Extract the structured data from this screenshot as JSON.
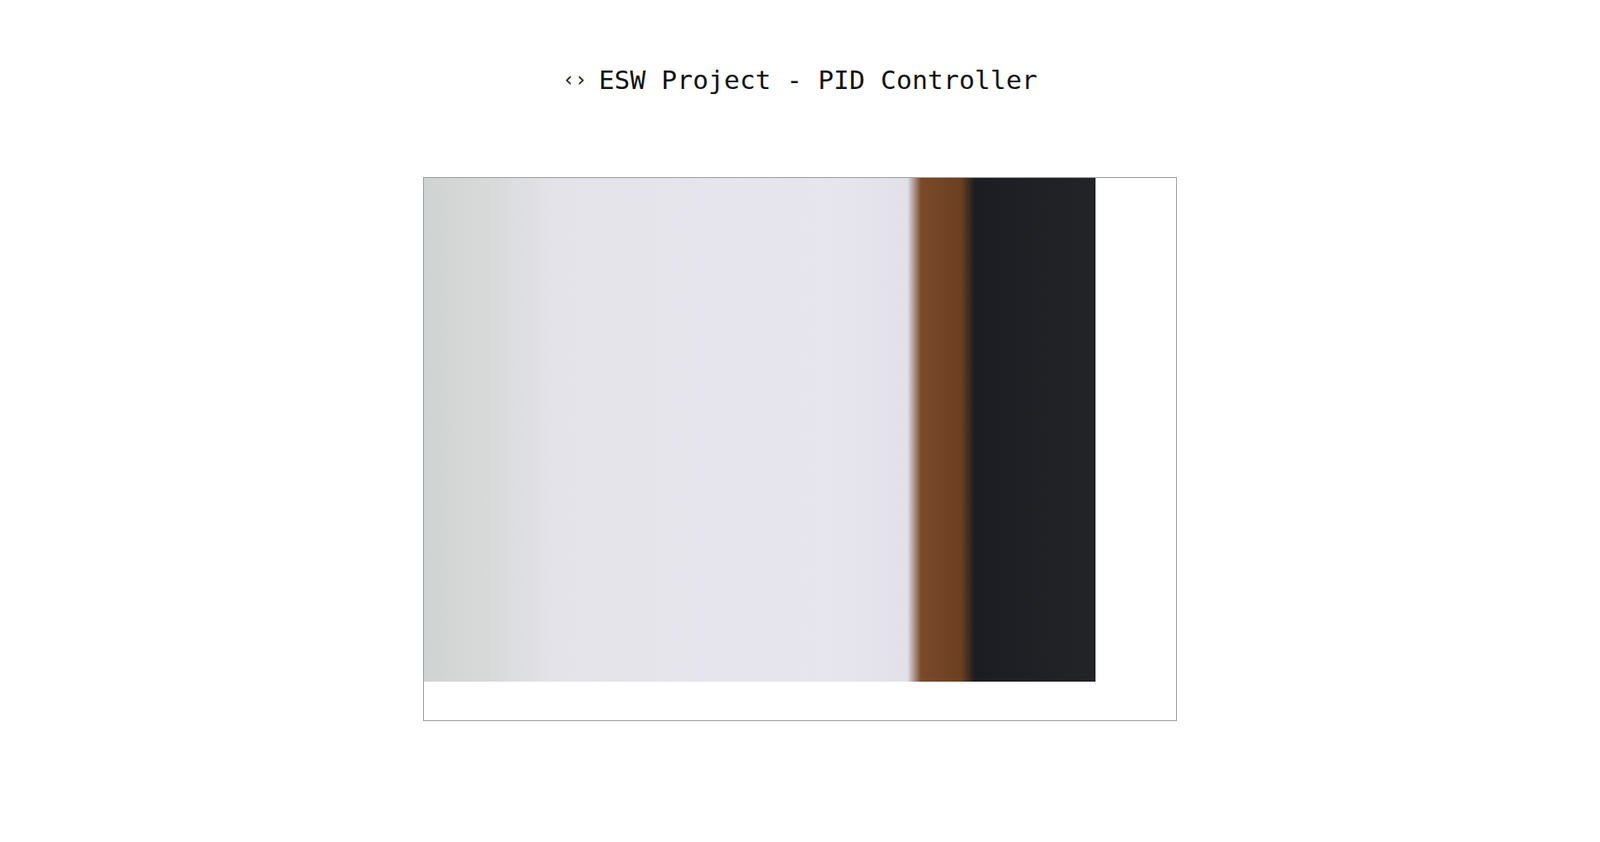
{
  "header": {
    "icon": "‹›",
    "title": "ESW Project - PID Controller"
  }
}
